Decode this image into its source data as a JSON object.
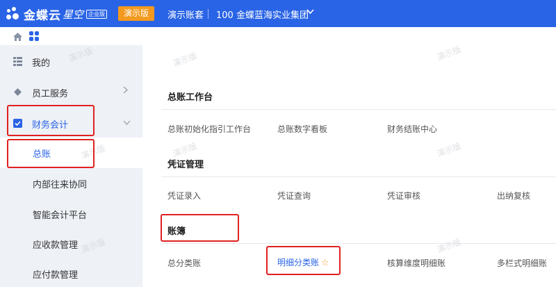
{
  "topbar": {
    "logo_text": "金蝶云",
    "logo_sub": "星空",
    "edition_badge": "企业版",
    "demo_label": "演示版",
    "account_set": "演示账套",
    "organization": "100 金蝶蓝海实业集团"
  },
  "sidebar": {
    "items": [
      {
        "label": "我的"
      },
      {
        "label": "员工服务"
      },
      {
        "label": "财务会计"
      }
    ],
    "sub_items": [
      {
        "label": "总账"
      },
      {
        "label": "内部往来协同"
      },
      {
        "label": "智能会计平台"
      },
      {
        "label": "应收款管理"
      },
      {
        "label": "应付款管理"
      }
    ]
  },
  "main": {
    "sections": [
      {
        "title": "总账工作台",
        "links": [
          "总账初始化指引工作台",
          "总账数字看板",
          "财务结账中心"
        ]
      },
      {
        "title": "凭证管理",
        "links": [
          "凭证录入",
          "凭证查询",
          "凭证审核",
          "出纳复核"
        ]
      },
      {
        "title": "账簿",
        "links": [
          "总分类账",
          "明细分类账",
          "核算维度明细账",
          "多栏式明细账"
        ]
      }
    ]
  },
  "watermark": "演示版",
  "colors": {
    "brand": "#2a64e6",
    "demo": "#f39a1e",
    "highlight": "#e02020"
  }
}
